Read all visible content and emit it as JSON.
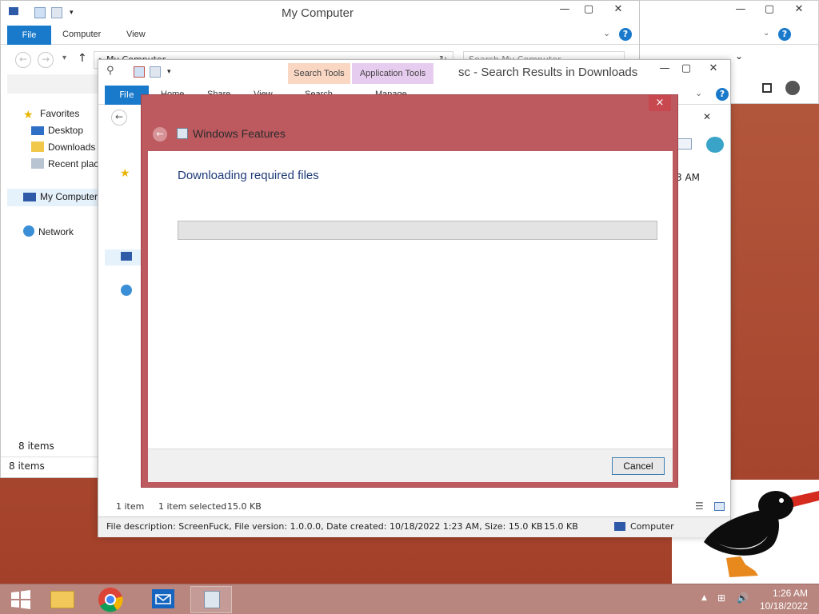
{
  "back_window": {
    "title": "My Computer",
    "tabs": {
      "file": "File",
      "computer": "Computer",
      "view": "View"
    },
    "address": "My Computer",
    "search_placeholder": "Search My Computer",
    "nav": {
      "favorites": "Favorites",
      "desktop": "Desktop",
      "downloads": "Downloads",
      "recent": "Recent places",
      "my_computer": "My Computer",
      "network": "Network"
    },
    "items_count_1": "8 items",
    "items_count_2": "8 items"
  },
  "mid_window": {
    "title": "sc - Search Results in Downloads",
    "context_tabs": {
      "search_tools": "Search Tools",
      "application_tools": "Application Tools"
    },
    "tabs": {
      "file": "File",
      "home": "Home",
      "share": "Share",
      "view": "View",
      "search": "Search",
      "manage": "Manage"
    },
    "time_fragment": "3 AM",
    "status": {
      "count": "1 item",
      "selected": "1 item selected",
      "size": "15.0 KB"
    },
    "details": {
      "description": "File description: ScreenFuck, File version: 1.0.0.0, Date created: 10/18/2022 1:23 AM, Size: 15.0 KB",
      "size": "15.0 KB",
      "location": "Computer"
    }
  },
  "dialog": {
    "title": "Windows Features",
    "heading": "Downloading required files",
    "progress": 0,
    "cancel_label": "Cancel",
    "close_glyph": "×",
    "back_glyph": "←"
  },
  "taskbar": {
    "time": "1:26 AM",
    "date": "10/18/2022"
  },
  "colors": {
    "accent_blue": "#1979ca",
    "dialog_frame": "#bd5a60",
    "taskbar": "#b8867f",
    "heading_blue": "#1e3b78"
  }
}
